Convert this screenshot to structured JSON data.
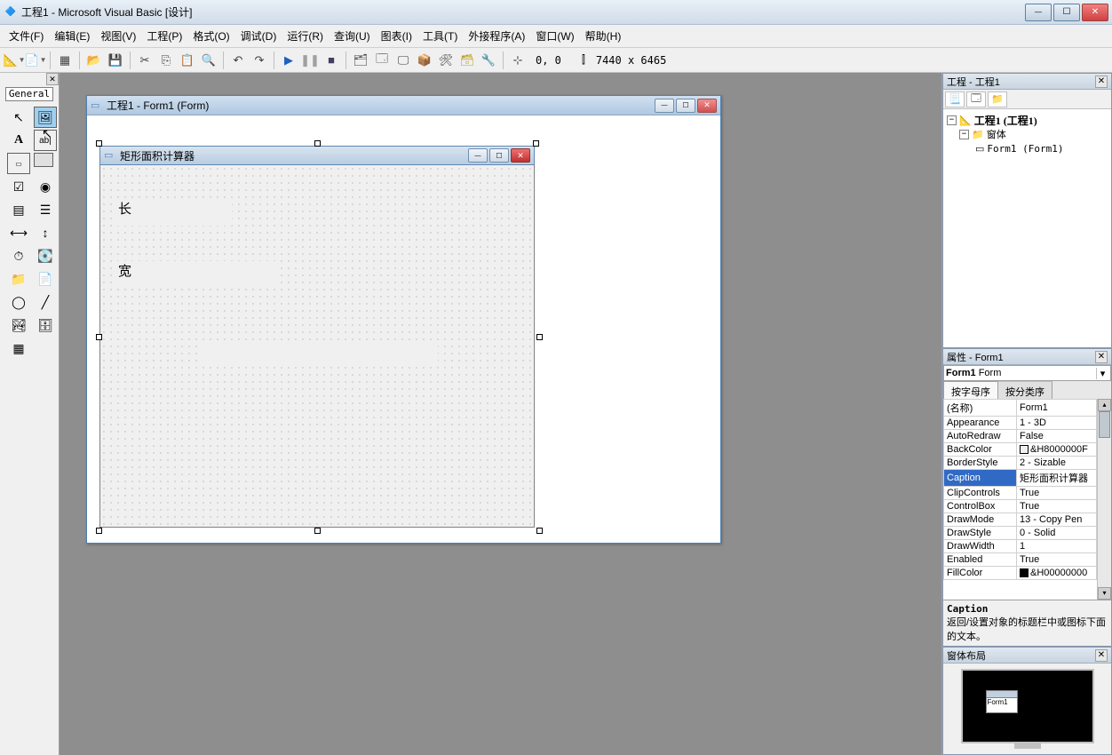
{
  "window": {
    "title": "工程1 - Microsoft Visual Basic [设计]"
  },
  "menu": [
    "文件(F)",
    "编辑(E)",
    "视图(V)",
    "工程(P)",
    "格式(O)",
    "调试(D)",
    "运行(R)",
    "查询(U)",
    "图表(I)",
    "工具(T)",
    "外接程序(A)",
    "窗口(W)",
    "帮助(H)"
  ],
  "toolbar": {
    "coords": "0, 0",
    "dimensions": "7440 x 6465"
  },
  "toolbox": {
    "tab": "General"
  },
  "designer": {
    "outer_title": "工程1 - Form1 (Form)",
    "form_caption": "矩形面积计算器",
    "labels": {
      "length": "长",
      "width": "宽"
    }
  },
  "project_panel": {
    "title": "工程 - 工程1",
    "root": "工程1 (工程1)",
    "folder": "窗体",
    "form": "Form1 (Form1)"
  },
  "properties_panel": {
    "title": "属性 - Form1",
    "combo_name": "Form1",
    "combo_type": "Form",
    "tabs": [
      "按字母序",
      "按分类序"
    ],
    "rows": [
      {
        "name": "(名称)",
        "val": "Form1"
      },
      {
        "name": "Appearance",
        "val": "1 - 3D"
      },
      {
        "name": "AutoRedraw",
        "val": "False"
      },
      {
        "name": "BackColor",
        "val": "&H8000000F",
        "sw": "#f0f0f0"
      },
      {
        "name": "BorderStyle",
        "val": "2 - Sizable"
      },
      {
        "name": "Caption",
        "val": "矩形面积计算器",
        "sel": true
      },
      {
        "name": "ClipControls",
        "val": "True"
      },
      {
        "name": "ControlBox",
        "val": "True"
      },
      {
        "name": "DrawMode",
        "val": "13 - Copy Pen"
      },
      {
        "name": "DrawStyle",
        "val": "0 - Solid"
      },
      {
        "name": "DrawWidth",
        "val": "1"
      },
      {
        "name": "Enabled",
        "val": "True"
      },
      {
        "name": "FillColor",
        "val": "&H00000000",
        "sw": "#000000"
      }
    ],
    "help_name": "Caption",
    "help_text": "返回/设置对象的标题栏中或图标下面的文本。"
  },
  "layout_panel": {
    "title": "窗体布局",
    "mini_label": "Form1"
  }
}
